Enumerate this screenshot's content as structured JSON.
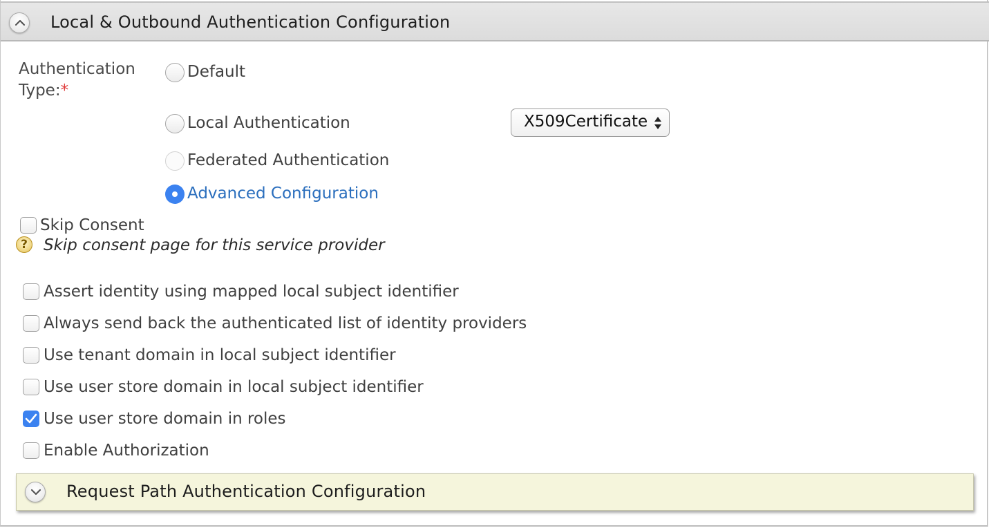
{
  "main_section": {
    "title": "Local & Outbound Authentication Configuration",
    "toggle_icon": "chevron-up-icon"
  },
  "auth_type": {
    "label_line1": "Authentication",
    "label_line2": "Type:",
    "required_mark": "*",
    "options": [
      {
        "label": "Default",
        "checked": false
      },
      {
        "label": "Local Authentication",
        "checked": false
      },
      {
        "label": "Federated Authentication",
        "checked": false
      },
      {
        "label": "Advanced Configuration",
        "checked": true
      }
    ],
    "local_auth_select": {
      "value": "X509Certificate"
    }
  },
  "skip_consent": {
    "label": "Skip Consent",
    "checked": false,
    "help_icon": "question-icon",
    "help_text": "Skip consent page for this service provider"
  },
  "options": [
    {
      "label": "Assert identity using mapped local subject identifier",
      "checked": false
    },
    {
      "label": "Always send back the authenticated list of identity providers",
      "checked": false
    },
    {
      "label": "Use tenant domain in local subject identifier",
      "checked": false
    },
    {
      "label": "Use user store domain in local subject identifier",
      "checked": false
    },
    {
      "label": "Use user store domain in roles",
      "checked": true
    },
    {
      "label": "Enable Authorization",
      "checked": false
    }
  ],
  "sub_section": {
    "title": "Request Path Authentication Configuration",
    "toggle_icon": "chevron-down-icon"
  },
  "colors": {
    "accent": "#3b82f0",
    "selected_text": "#2a6ebd",
    "required": "#e03a3a",
    "sub_header_bg": "#f5f5dc"
  }
}
